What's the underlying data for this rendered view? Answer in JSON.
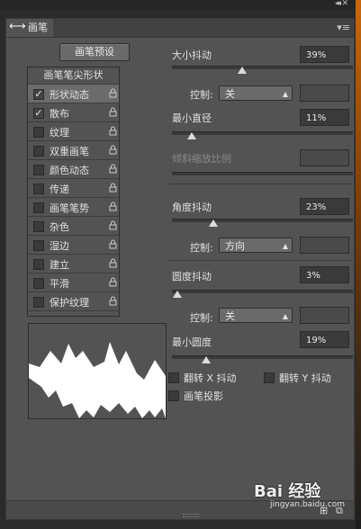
{
  "tab": {
    "title": "画笔"
  },
  "preset_button": "画笔预设",
  "list_header": "画笔笔尖形状",
  "list_items": [
    {
      "label": "形状动态",
      "checked": true,
      "selected": true
    },
    {
      "label": "散布",
      "checked": true,
      "selected": false
    },
    {
      "label": "纹理",
      "checked": false,
      "selected": false
    },
    {
      "label": "双重画笔",
      "checked": false,
      "selected": false
    },
    {
      "label": "颜色动态",
      "checked": false,
      "selected": false
    },
    {
      "label": "传递",
      "checked": false,
      "selected": false
    },
    {
      "label": "画笔笔势",
      "checked": false,
      "selected": false
    },
    {
      "label": "杂色",
      "checked": false,
      "selected": false
    },
    {
      "label": "湿边",
      "checked": false,
      "selected": false
    },
    {
      "label": "建立",
      "checked": false,
      "selected": false
    },
    {
      "label": "平滑",
      "checked": false,
      "selected": false
    },
    {
      "label": "保护纹理",
      "checked": false,
      "selected": false
    }
  ],
  "controls": {
    "size_jitter": {
      "label": "大小抖动",
      "value": "39%",
      "level": 0.39
    },
    "size_control": {
      "label": "控制:",
      "value": "关"
    },
    "min_diameter": {
      "label": "最小直径",
      "value": "11%",
      "level": 0.11
    },
    "tilt_scale": {
      "label": "倾斜缩放比例",
      "value": ""
    },
    "angle_jitter": {
      "label": "角度抖动",
      "value": "23%",
      "level": 0.23
    },
    "angle_control": {
      "label": "控制:",
      "value": "方向"
    },
    "roundness_jitter": {
      "label": "圆度抖动",
      "value": "3%",
      "level": 0.03
    },
    "roundness_control": {
      "label": "控制:",
      "value": "关"
    },
    "min_roundness": {
      "label": "最小圆度",
      "value": "19%",
      "level": 0.19
    }
  },
  "checkboxes": {
    "flip_x": "翻转 X 抖动",
    "flip_y": "翻转 Y 抖动",
    "brush_projection": "画笔投影"
  },
  "watermark": {
    "main": "Bai 经验",
    "sub": "jingyan.baidu.com"
  }
}
